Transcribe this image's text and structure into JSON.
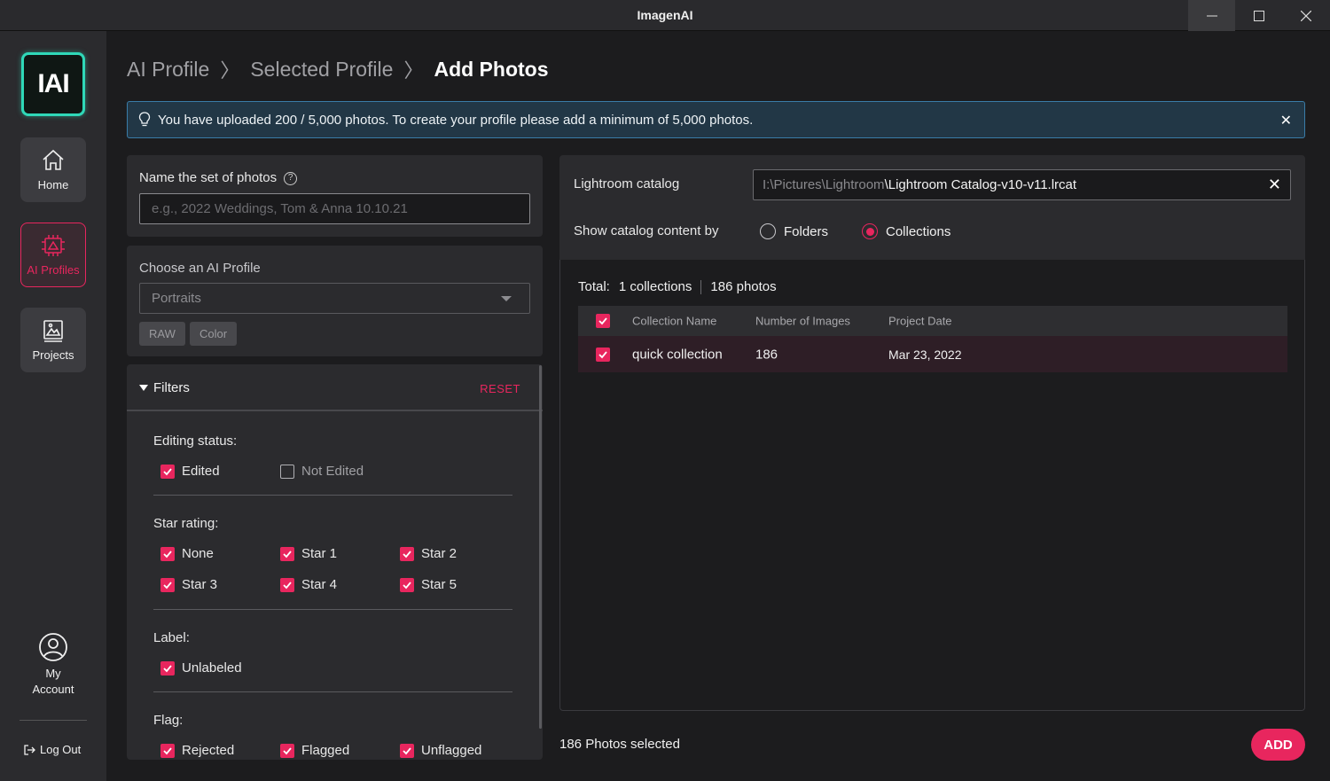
{
  "window": {
    "title": "ImagenAI"
  },
  "logo": {
    "text": "IAI",
    "accent": "#2fd8b8"
  },
  "sidebar": {
    "items": [
      {
        "label": "Home",
        "icon": "home-icon"
      },
      {
        "label": "AI Profiles",
        "icon": "ai-profiles-icon",
        "active": true
      },
      {
        "label": "Projects",
        "icon": "projects-icon"
      }
    ],
    "account_line1": "My",
    "account_line2": "Account",
    "logout": "Log Out"
  },
  "breadcrumb": {
    "items": [
      "AI Profile",
      "Selected Profile"
    ],
    "current": "Add Photos",
    "separator": "〉"
  },
  "banner": {
    "message": "You have uploaded 200 / 5,000 photos. To create your profile please add a minimum of 5,000 photos."
  },
  "name_set": {
    "label": "Name the set of photos",
    "placeholder": "e.g., 2022 Weddings, Tom & Anna 10.10.21"
  },
  "ai_profile": {
    "label": "Choose an AI Profile",
    "selected": "Portraits",
    "tags": [
      "RAW",
      "Color"
    ]
  },
  "filters": {
    "title": "Filters",
    "reset": "RESET",
    "editing_status": {
      "title": "Editing status:",
      "options": [
        {
          "label": "Edited",
          "checked": true
        },
        {
          "label": "Not Edited",
          "checked": false
        }
      ]
    },
    "star_rating": {
      "title": "Star rating:",
      "options": [
        {
          "label": "None",
          "checked": true
        },
        {
          "label": "Star 1",
          "checked": true
        },
        {
          "label": "Star 2",
          "checked": true
        },
        {
          "label": "Star 3",
          "checked": true
        },
        {
          "label": "Star 4",
          "checked": true
        },
        {
          "label": "Star 5",
          "checked": true
        }
      ]
    },
    "label": {
      "title": "Label:",
      "options": [
        {
          "label": "Unlabeled",
          "checked": true
        }
      ]
    },
    "flag": {
      "title": "Flag:",
      "options": [
        {
          "label": "Rejected",
          "checked": true
        },
        {
          "label": "Flagged",
          "checked": true
        },
        {
          "label": "Unflagged",
          "checked": true
        }
      ]
    }
  },
  "catalog": {
    "label": "Lightroom catalog",
    "path_dir": "I:\\Pictures\\Lightroom",
    "path_file": "\\Lightroom Catalog-v10-v11.lrcat",
    "show_by_label": "Show catalog content by",
    "options": [
      {
        "label": "Folders",
        "selected": false
      },
      {
        "label": "Collections",
        "selected": true
      }
    ]
  },
  "totals": {
    "label": "Total:",
    "collections": "1 collections",
    "photos": "186 photos"
  },
  "table": {
    "columns": [
      "Collection Name",
      "Number of Images",
      "Project Date"
    ],
    "rows": [
      {
        "checked": true,
        "name": "quick collection",
        "count": "186",
        "date": "Mar 23, 2022"
      }
    ]
  },
  "footer": {
    "selected": "186 Photos selected",
    "add": "ADD"
  },
  "colors": {
    "accent": "#e8265e",
    "banner_border": "#3a7ca8"
  }
}
